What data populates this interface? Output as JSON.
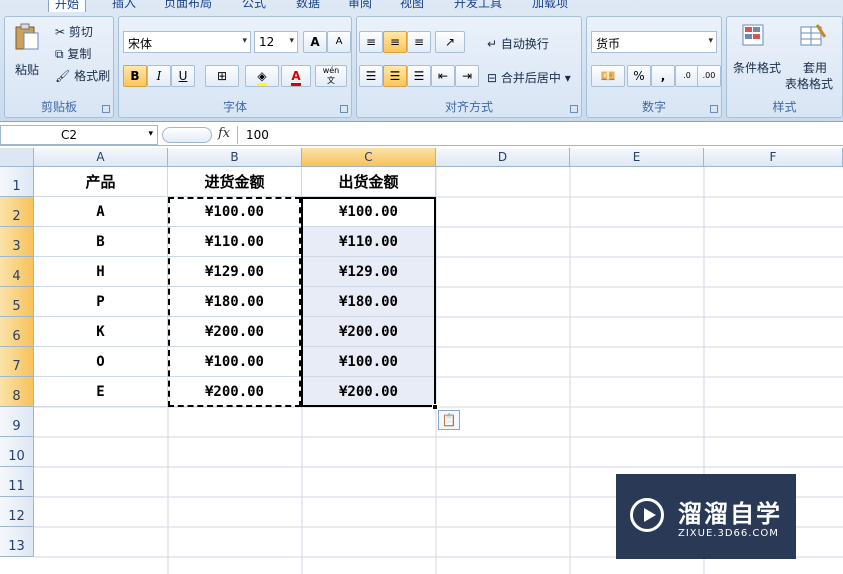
{
  "tabs": [
    "开始",
    "插入",
    "页面布局",
    "公式",
    "数据",
    "审阅",
    "视图",
    "开发工具",
    "加载项"
  ],
  "clipboard": {
    "paste": "粘贴",
    "cut": "剪切",
    "copy": "复制",
    "format_painter": "格式刷",
    "label": "剪贴板"
  },
  "font": {
    "name": "宋体",
    "size": "12",
    "bold": "B",
    "italic": "I",
    "underline": "U",
    "grow": "A",
    "shrink": "A",
    "label": "字体",
    "phonetic": "wén"
  },
  "alignment": {
    "wrap_text": "自动换行",
    "merge_center": "合并后居中",
    "label": "对齐方式"
  },
  "number": {
    "format": "货币",
    "percent": "%",
    "comma": ",",
    "inc_decimal": "←.0 .00",
    "dec_decimal": ".00 →.0",
    "label": "数字"
  },
  "styles": {
    "conditional": "条件格式",
    "table_format_1": "套用",
    "table_format_2": "表格格式",
    "label": "样式"
  },
  "formula_bar": {
    "name_box": "C2",
    "fx": "fx",
    "value": "100"
  },
  "columns": [
    "A",
    "B",
    "C",
    "D",
    "E",
    "F"
  ],
  "rows": [
    "1",
    "2",
    "3",
    "4",
    "5",
    "6",
    "7",
    "8",
    "9",
    "10",
    "11",
    "12",
    "13"
  ],
  "table": {
    "headers": [
      "产品",
      "进货金额",
      "出货金额"
    ],
    "data": [
      [
        "A",
        "¥100.00",
        "¥100.00"
      ],
      [
        "B",
        "¥110.00",
        "¥110.00"
      ],
      [
        "H",
        "¥129.00",
        "¥129.00"
      ],
      [
        "P",
        "¥180.00",
        "¥180.00"
      ],
      [
        "K",
        "¥200.00",
        "¥200.00"
      ],
      [
        "O",
        "¥100.00",
        "¥100.00"
      ],
      [
        "E",
        "¥200.00",
        "¥200.00"
      ]
    ]
  },
  "watermark": {
    "title": "溜溜自学",
    "sub": "ZIXUE.3D66.COM"
  },
  "colors": {
    "accent": "#15428b",
    "selected_header": "#f7c25b"
  }
}
